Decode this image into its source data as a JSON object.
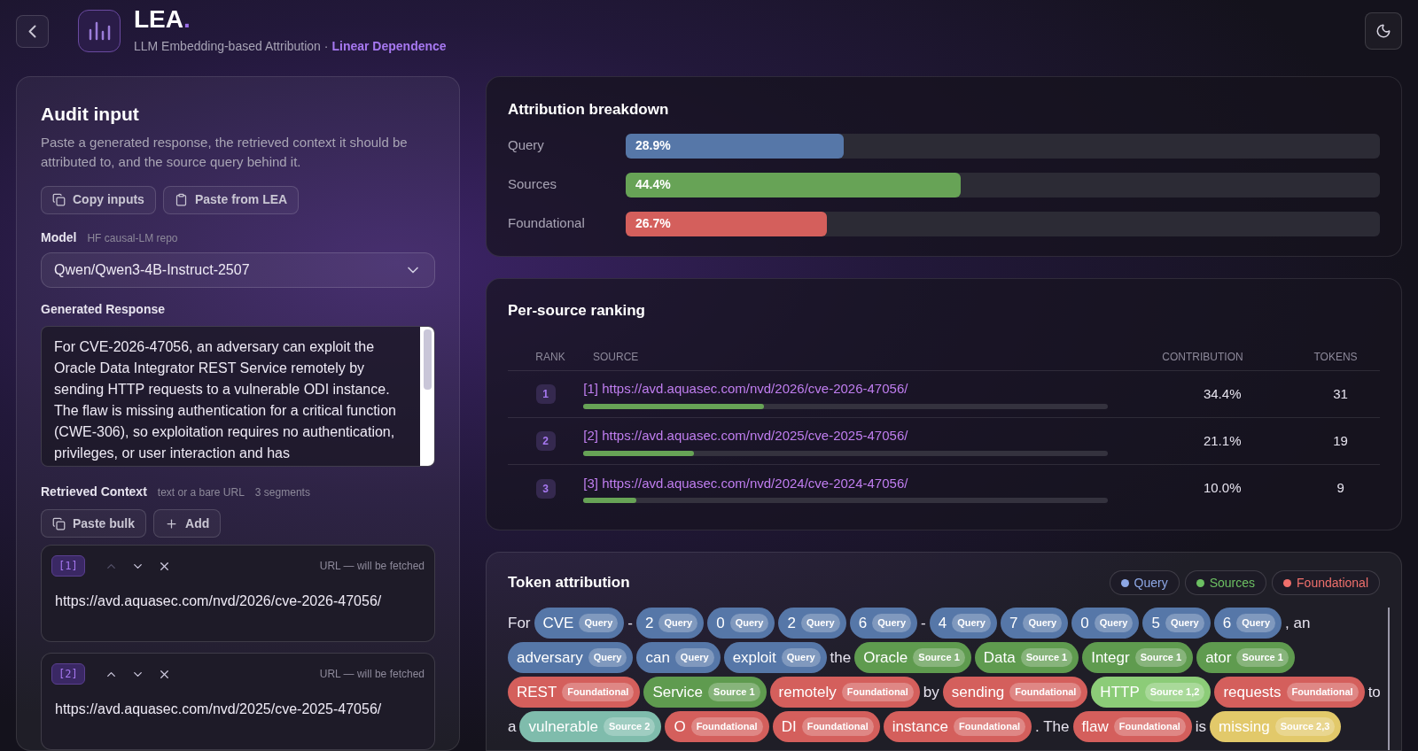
{
  "header": {
    "title": "LEA",
    "title_dot": ".",
    "subtitle": "LLM Embedding-based Attribution ·",
    "subtitle_accent": "Linear Dependence"
  },
  "audit": {
    "title": "Audit input",
    "description": "Paste a generated response, the retrieved context it should be attributed to, and the source query behind it.",
    "buttons": [
      {
        "label": "Copy inputs",
        "kind": "copy"
      },
      {
        "label": "Paste from LEA",
        "kind": "clipboard"
      }
    ],
    "model": {
      "label": "Model",
      "hint": "HF causal-LM repo",
      "value": "Qwen/Qwen3-4B-Instruct-2507"
    },
    "response": {
      "label": "Generated Response",
      "value": "For CVE-2026-47056, an adversary can exploit the Oracle Data Integrator REST Service remotely by sending HTTP requests to a vulnerable ODI instance. The flaw is missing authentication for a critical function (CWE-306), so exploitation requires no authentication, privileges, or user interaction and has"
    },
    "context": {
      "label": "Retrieved Context",
      "hint": "text or a bare URL",
      "count": "3 segments",
      "buttons": [
        {
          "label": "Paste bulk",
          "kind": "copy"
        },
        {
          "label": "Add",
          "kind": "plus"
        }
      ],
      "segments": [
        {
          "index": "[1]",
          "status": "URL — will be fetched",
          "value": "https://avd.aquasec.com/nvd/2026/cve-2026-47056/",
          "up_disabled": true
        },
        {
          "index": "[2]",
          "status": "URL — will be fetched",
          "value": "https://avd.aquasec.com/nvd/2025/cve-2025-47056/",
          "up_disabled": false
        }
      ]
    }
  },
  "breakdown": {
    "title": "Attribution breakdown",
    "rows": [
      {
        "label": "Query",
        "value": "28.9%",
        "level": 0.289,
        "color": "#5677a8"
      },
      {
        "label": "Sources",
        "value": "44.4%",
        "level": 0.444,
        "color": "#67a356"
      },
      {
        "label": "Foundational",
        "value": "26.7%",
        "level": 0.267,
        "color": "#d45f5c"
      }
    ]
  },
  "ranking": {
    "title": "Per-source ranking",
    "columns": [
      "RANK",
      "SOURCE",
      "CONTRIBUTION",
      "TOKENS"
    ],
    "rows": [
      {
        "rank": "1",
        "source": "[1] https://avd.aquasec.com/nvd/2026/cve-2026-47056/",
        "contribution": "34.4%",
        "tokens": "31",
        "level": 0.344
      },
      {
        "rank": "2",
        "source": "[2] https://avd.aquasec.com/nvd/2025/cve-2025-47056/",
        "contribution": "21.1%",
        "tokens": "19",
        "level": 0.211
      },
      {
        "rank": "3",
        "source": "[3] https://avd.aquasec.com/nvd/2024/cve-2024-47056/",
        "contribution": "10.0%",
        "tokens": "9",
        "level": 0.1
      }
    ]
  },
  "tokens": {
    "title": "Token attribution",
    "legend": [
      {
        "label": "Query",
        "color": "#8ea8e6"
      },
      {
        "label": "Sources",
        "color": "#6cbf62"
      },
      {
        "label": "Foundational",
        "color": "#f0706c"
      }
    ],
    "lines": [
      [
        {
          "kind": "text",
          "text": "For"
        },
        {
          "kind": "token",
          "text": "CVE",
          "tag": "Query",
          "color": "#5677a8"
        },
        {
          "kind": "text",
          "text": "-"
        },
        {
          "kind": "token",
          "text": "2",
          "tag": "Query",
          "color": "#5677a8"
        },
        {
          "kind": "token",
          "text": "0",
          "tag": "Query",
          "color": "#5677a8"
        },
        {
          "kind": "token",
          "text": "2",
          "tag": "Query",
          "color": "#5677a8"
        },
        {
          "kind": "token",
          "text": "6",
          "tag": "Query",
          "color": "#5677a8"
        },
        {
          "kind": "text",
          "text": "-"
        },
        {
          "kind": "token",
          "text": "4",
          "tag": "Query",
          "color": "#5677a8"
        },
        {
          "kind": "token",
          "text": "7",
          "tag": "Query",
          "color": "#5677a8"
        },
        {
          "kind": "token",
          "text": "0",
          "tag": "Query",
          "color": "#5677a8"
        },
        {
          "kind": "token",
          "text": "5",
          "tag": "Query",
          "color": "#5677a8"
        },
        {
          "kind": "token",
          "text": "6",
          "tag": "Query",
          "color": "#5677a8"
        },
        {
          "kind": "text",
          "text": ", an"
        }
      ],
      [
        {
          "kind": "token",
          "text": "adversary",
          "tag": "Query",
          "color": "#5677a8"
        },
        {
          "kind": "token",
          "text": "can",
          "tag": "Query",
          "color": "#5677a8"
        },
        {
          "kind": "token",
          "text": "exploit",
          "tag": "Query",
          "color": "#5677a8"
        },
        {
          "kind": "text",
          "text": "the"
        },
        {
          "kind": "token",
          "text": "Oracle",
          "tag": "Source 1",
          "color": "#5f9b4f"
        },
        {
          "kind": "token",
          "text": "Data",
          "tag": "Source 1",
          "color": "#5f9b4f"
        },
        {
          "kind": "token",
          "text": "Integr",
          "tag": "Source 1",
          "color": "#5f9b4f"
        },
        {
          "kind": "token",
          "text": "ator",
          "tag": "Source 1",
          "color": "#5f9b4f"
        }
      ],
      [
        {
          "kind": "token",
          "text": "REST",
          "tag": "Foundational",
          "color": "#d45f5c"
        },
        {
          "kind": "token",
          "text": "Service",
          "tag": "Source 1",
          "color": "#5f9b4f"
        },
        {
          "kind": "token",
          "text": "remotely",
          "tag": "Foundational",
          "color": "#d45f5c"
        },
        {
          "kind": "text",
          "text": "by"
        },
        {
          "kind": "token",
          "text": "sending",
          "tag": "Foundational",
          "color": "#d45f5c"
        },
        {
          "kind": "token",
          "text": "HTTP",
          "tag": "Source 1,2",
          "color": "#8ccc78"
        },
        {
          "kind": "token",
          "text": "requests",
          "tag": "Foundational",
          "color": "#d45f5c"
        },
        {
          "kind": "text",
          "text": "to"
        }
      ],
      [
        {
          "kind": "text",
          "text": "a"
        },
        {
          "kind": "token",
          "text": "vulnerable",
          "tag": "Source 2",
          "color": "#7fbcac"
        },
        {
          "kind": "token",
          "text": "O",
          "tag": "Foundational",
          "color": "#d45f5c"
        },
        {
          "kind": "token",
          "text": "DI",
          "tag": "Foundational",
          "color": "#d45f5c"
        },
        {
          "kind": "token",
          "text": "instance",
          "tag": "Foundational",
          "color": "#d45f5c"
        },
        {
          "kind": "text",
          "text": ". The"
        },
        {
          "kind": "token",
          "text": "flaw",
          "tag": "Foundational",
          "color": "#d45f5c"
        },
        {
          "kind": "text",
          "text": "is"
        },
        {
          "kind": "token",
          "text": "missing",
          "tag": "Source 2,3",
          "color": "#e2c96a"
        }
      ]
    ]
  }
}
